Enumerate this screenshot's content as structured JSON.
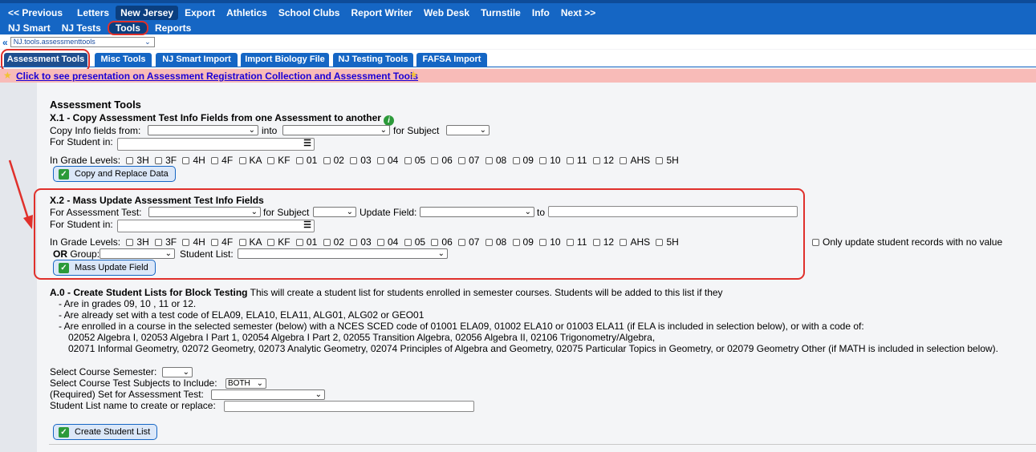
{
  "topnav": {
    "row1": [
      "<< Previous",
      "Letters",
      "New Jersey",
      "Export",
      "Athletics",
      "School Clubs",
      "Report Writer",
      "Web Desk",
      "Turnstile",
      "Info",
      "Next >>"
    ],
    "row2": [
      "NJ Smart",
      "NJ Tests",
      "Tools",
      "Reports"
    ]
  },
  "crumb": {
    "value": "NJ.tools.assessmenttools"
  },
  "tabs": [
    "Assessment Tools",
    "Misc Tools",
    "NJ Smart Import",
    "Import Biology File",
    "NJ Testing Tools",
    "FAFSA Import"
  ],
  "banner": {
    "link": "Click to see presentation on Assessment Registration Collection and Assessment Tools"
  },
  "page_title": "Assessment Tools",
  "grades": [
    "3H",
    "3F",
    "4H",
    "4F",
    "KA",
    "KF",
    "01",
    "02",
    "03",
    "04",
    "05",
    "06",
    "07",
    "08",
    "09",
    "10",
    "11",
    "12",
    "AHS",
    "5H"
  ],
  "x1": {
    "title": "X.1 - Copy Assessment Test Info Fields from one Assessment to another",
    "copy_from": "Copy Info fields from:",
    "into": "into",
    "for_subject": "for Subject",
    "for_student": "For Student in:",
    "grade_levels": "In Grade Levels:",
    "button": "Copy and Replace Data"
  },
  "x2": {
    "title": "X.2 - Mass Update Assessment Test Info Fields",
    "for_test": "For Assessment Test:",
    "for_subject": "for Subject",
    "update_field": "Update Field:",
    "to": "to",
    "for_student": "For Student in:",
    "grade_levels": "In Grade Levels:",
    "only_update": "Only update student records with no value",
    "or": "OR",
    "group": "Group:",
    "student_list": "Student List:",
    "button": "Mass Update Field"
  },
  "a0": {
    "title": "A.0 - Create Student Lists for Block Testing",
    "desc": "This will create a student list for students enrolled in semester courses. Students will be added to this list if they",
    "lines": [
      "- Are in grades 09, 10 , 11 or 12.",
      "- Are already set with a test code of ELA09, ELA10, ELA11, ALG01, ALG02 or GEO01",
      "- Are enrolled in a course in the selected semester (below) with a NCES SCED code of 01001 ELA09, 01002 ELA10 or 01003 ELA11 (if ELA is included in selection below), or with a code of:",
      "02052 Algebra I, 02053 Algebra I Part 1, 02054 Algebra I Part 2, 02055 Transition Algebra, 02056 Algebra II, 02106 Trigonometry/Algebra,",
      "02071 Informal Geometry, 02072 Geometry, 02073 Analytic Geometry, 02074 Principles of Algebra and Geometry, 02075 Particular Topics in Geometry, or 02079 Geometry Other (if MATH is included in selection below)."
    ],
    "semester_label": "Select Course Semester:",
    "subjects_label": "Select Course Test Subjects to Include:",
    "subjects_value": "BOTH",
    "required_label": "(Required) Set for Assessment Test:",
    "listname_label": "Student List name to create or replace:",
    "button": "Create Student List"
  }
}
